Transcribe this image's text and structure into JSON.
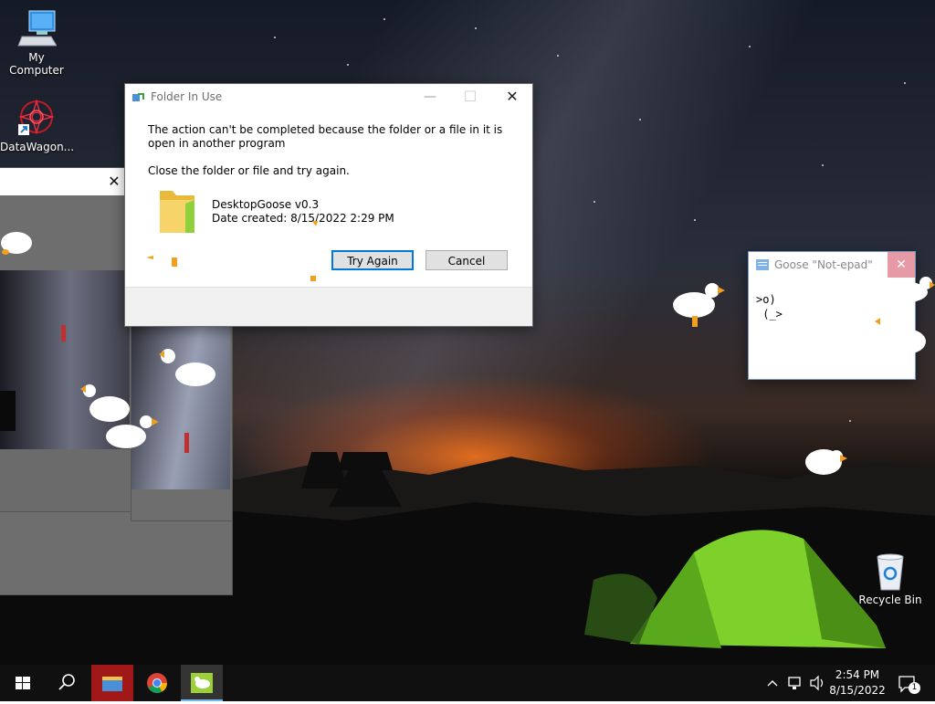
{
  "desktop": {
    "icons": [
      {
        "label": "My Computer",
        "icon": "computer-icon"
      },
      {
        "label": "DataWagon...",
        "icon": "datawagon-icon"
      },
      {
        "label": "Recycle Bin",
        "icon": "recycle-bin-icon"
      }
    ]
  },
  "dialog": {
    "title": "Folder In Use",
    "message": "The action can't be completed because the folder or a file in it is open in another program",
    "instruction": "Close the folder or file and try again.",
    "file_name": "DesktopGoose v0.3",
    "date_created": "Date created: 8/15/2022 2:29 PM",
    "try_again_label": "Try Again",
    "cancel_label": "Cancel",
    "close_glyph": "✕"
  },
  "gallery_windows": {
    "close_glyph": "✕"
  },
  "notepad": {
    "title": "Goose \"Not-epad\"",
    "line1": ">o)",
    "line2": " (_>",
    "close_glyph": "✕"
  },
  "taskbar": {
    "time": "2:54 PM",
    "date": "8/15/2022",
    "notification_count": "1",
    "apps": [
      "start-icon",
      "search-icon",
      "file-explorer-icon",
      "chrome-icon",
      "goose-app-icon"
    ]
  },
  "colors": {
    "accent": "#0078d7",
    "taskbar": "#101010",
    "notepad_close": "#e59aa6"
  }
}
